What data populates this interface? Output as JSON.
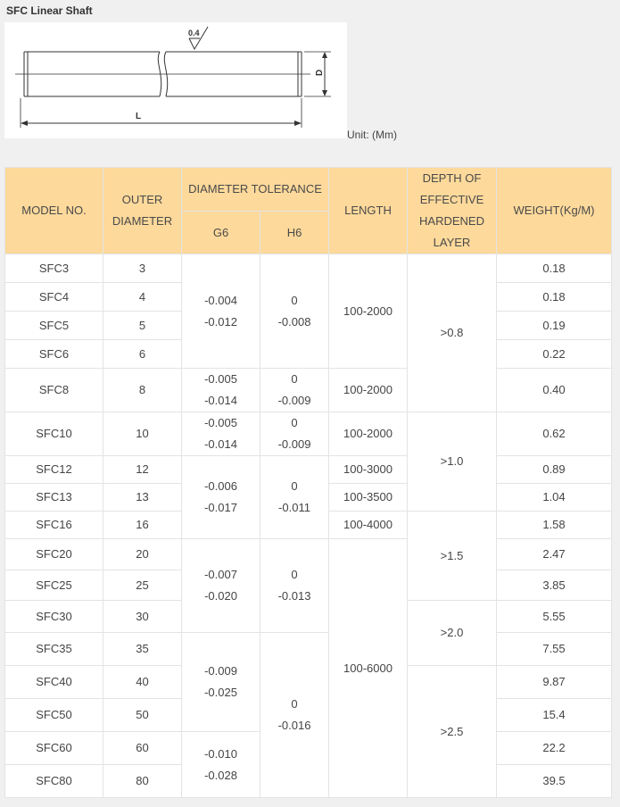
{
  "title": "SFC Linear Shaft",
  "drawing": {
    "roughness": "0.4",
    "length_label": "L",
    "diameter_label": "D"
  },
  "unit_label": "Unit: (Mm)",
  "headers": {
    "model": "MODEL NO.",
    "outer_diameter": [
      "OUTER",
      "DIAMETER"
    ],
    "diameter_tolerance": "DIAMETER TOLERANCE",
    "g6": "G6",
    "h6": "H6",
    "length": "LENGTH",
    "depth": [
      "DEPTH OF",
      "EFFECTIVE",
      "HARDENED",
      "LAYER"
    ],
    "weight": "WEIGHT(Kg/M)"
  },
  "models": [
    "SFC3",
    "SFC4",
    "SFC5",
    "SFC6",
    "SFC8",
    "SFC10",
    "SFC12",
    "SFC13",
    "SFC16",
    "SFC20",
    "SFC25",
    "SFC30",
    "SFC35",
    "SFC40",
    "SFC50",
    "SFC60",
    "SFC80"
  ],
  "diameters": [
    "3",
    "4",
    "5",
    "6",
    "8",
    "10",
    "12",
    "13",
    "16",
    "20",
    "25",
    "30",
    "35",
    "40",
    "50",
    "60",
    "80"
  ],
  "weights": [
    "0.18",
    "0.18",
    "0.19",
    "0.22",
    "0.40",
    "0.62",
    "0.89",
    "1.04",
    "1.58",
    "2.47",
    "3.85",
    "5.55",
    "7.55",
    "9.87",
    "15.4",
    "22.2",
    "39.5"
  ],
  "g6": [
    [
      "-0.004",
      "-0.012"
    ],
    [
      "-0.005",
      "-0.014"
    ],
    [
      "-0.005",
      "-0.014"
    ],
    [
      "-0.006",
      "-0.017"
    ],
    [
      "-0.007",
      "-0.020"
    ],
    [
      "-0.009",
      "-0.025"
    ],
    [
      "-0.010",
      "-0.028"
    ]
  ],
  "h6": [
    [
      "0",
      "-0.008"
    ],
    [
      "0",
      "-0.009"
    ],
    [
      "0",
      "-0.009"
    ],
    [
      "0",
      "-0.011"
    ],
    [
      "0",
      "-0.013"
    ],
    [
      "0",
      "-0.016"
    ]
  ],
  "lengths": [
    "100-2000",
    "100-2000",
    "100-2000",
    "100-3000",
    "100-3500",
    "100-4000",
    "100-6000"
  ],
  "depths": [
    ">0.8",
    ">1.0",
    ">1.5",
    ">2.0",
    ">2.5"
  ]
}
